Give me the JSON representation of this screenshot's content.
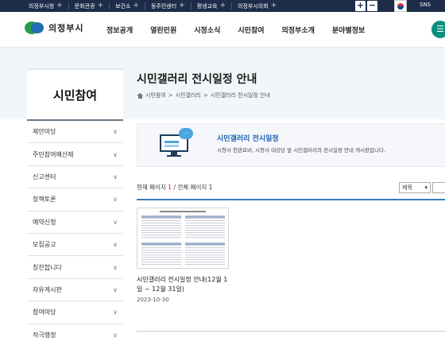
{
  "topbar": {
    "links": [
      "의정부시청",
      "문화관광",
      "보건소",
      "동주민센터",
      "평생교육",
      "의정부시의회"
    ],
    "zoom_in": "+",
    "zoom_out": "−",
    "sns": "SNS"
  },
  "header": {
    "logo_text": "의정부시",
    "menu": [
      "정보공개",
      "열린민원",
      "시정소식",
      "시민참여",
      "의정부소개",
      "분야별정보"
    ]
  },
  "sidebar": {
    "title": "시민참여",
    "items": [
      "제안마당",
      "주민참여예산제",
      "신고센터",
      "정책토론",
      "예약신청",
      "모집공고",
      "칭찬합니다",
      "자유게시판",
      "참여마당",
      "적극행정"
    ]
  },
  "page": {
    "title": "시민갤러리 전시일정 안내",
    "breadcrumb": [
      "시민참여",
      "시민갤러리",
      "시민갤러리 전시일정 안내"
    ],
    "intro_title": "시민갤러리 전시일정",
    "intro_desc": "시청사 현관로비, 시청사 대강당 앞 시민갤러리의 전시일정 안내 게시판입니다.",
    "bubble": "..."
  },
  "paging": {
    "prefix": "현재 페이지",
    "current": "1",
    "middle": "/ 전체 페이지",
    "total": "1"
  },
  "search": {
    "select_value": "제목"
  },
  "posts": [
    {
      "title": "시민갤러리 전시일정 안내(12월 1일 ~ 12월 31일)",
      "date": "2023-10-30"
    }
  ],
  "colors": {
    "topbar": "#1d2c48",
    "accent_blue": "#1a5fb4",
    "sitemap_green": "#0b8f7c",
    "band": "#f2f6f8"
  }
}
